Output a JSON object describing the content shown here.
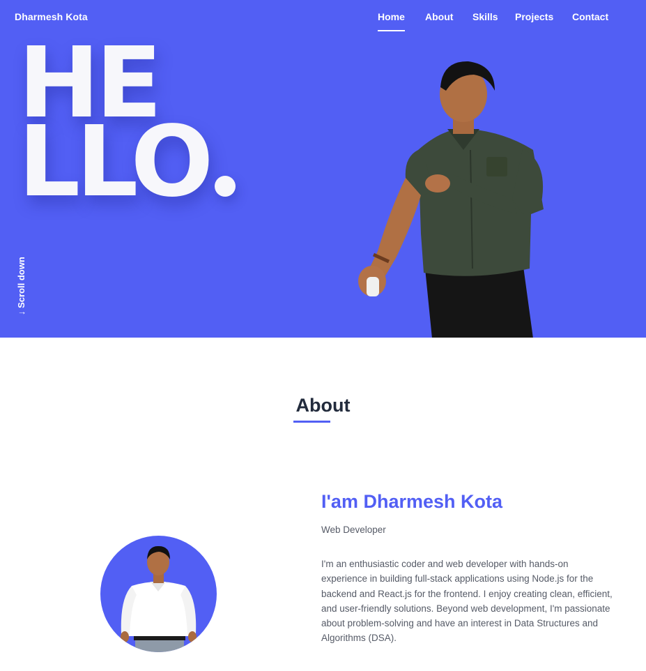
{
  "brand": "Dharmesh Kota",
  "nav": {
    "items": [
      {
        "label": "Home",
        "active": true
      },
      {
        "label": "About",
        "active": false
      },
      {
        "label": "Skills",
        "active": false
      },
      {
        "label": "Projects",
        "active": false
      },
      {
        "label": "Contact",
        "active": false
      }
    ]
  },
  "hero": {
    "hello_line1": "HE",
    "hello_line2": "LLO",
    "scroll_label": "↓ Scroll down"
  },
  "about": {
    "section_title": "About",
    "name": "I'am Dharmesh Kota",
    "role": "Web Developer",
    "description": "I'm an enthusiastic coder and web developer with hands-on experience in building full-stack applications using Node.js for the backend and React.js for the frontend. I enjoy creating clean, efficient, and user-friendly solutions. Beyond web development, I'm passionate about problem-solving and have an interest in Data Structures and Algorithms (DSA)."
  },
  "colors": {
    "accent": "#525ff4",
    "hero_text": "#f7f7fb",
    "heading": "#222b3c",
    "body_text": "#555a66"
  }
}
